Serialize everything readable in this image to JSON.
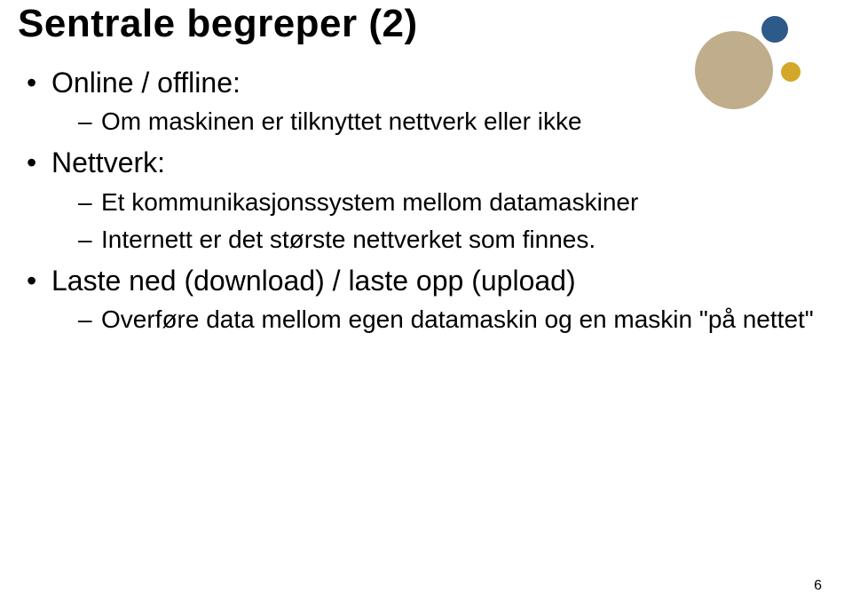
{
  "title": "Sentrale begreper (2)",
  "bullets": [
    {
      "text": "Online / offline:",
      "children": [
        "Om maskinen er tilknyttet nettverk eller ikke"
      ]
    },
    {
      "text": "Nettverk:",
      "children": [
        "Et kommunikasjonssystem mellom datamaskiner",
        "Internett er det største nettverket som finnes."
      ]
    },
    {
      "text": "Laste ned (download) / laste opp (upload)",
      "children": [
        "Overføre data mellom egen datamaskin og en maskin \"på nettet\""
      ]
    }
  ],
  "page_number": "6",
  "colors": {
    "accent_blue": "#2e5a8a",
    "accent_tan": "#c0ad8b",
    "accent_gold": "#d3a82a"
  }
}
